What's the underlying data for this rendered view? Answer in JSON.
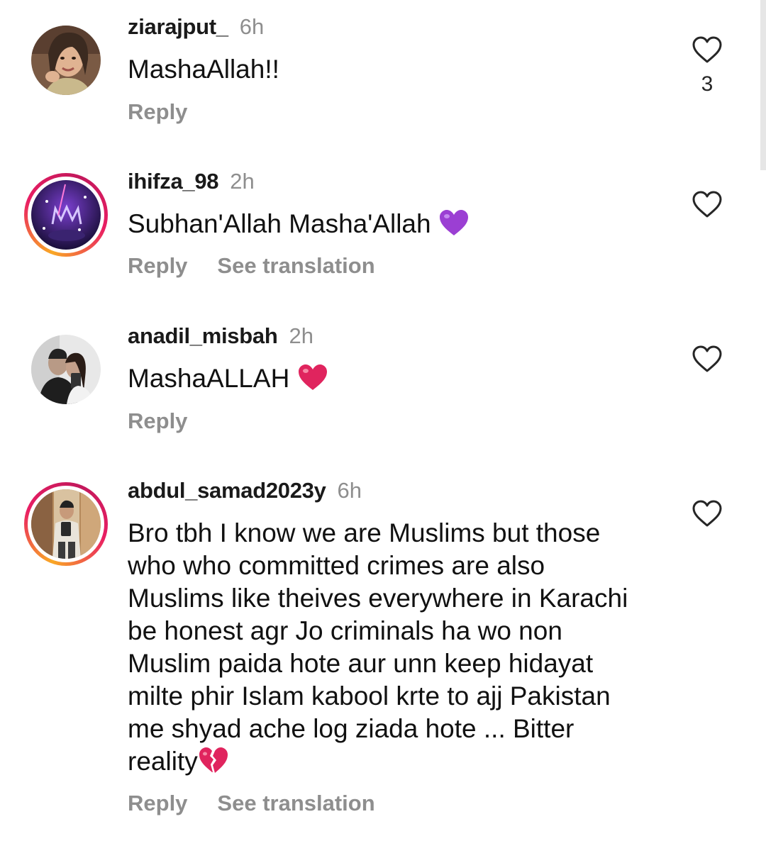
{
  "comments": [
    {
      "username": "ziarajput_",
      "time": "6h",
      "text": "MashaAllah!!",
      "reply_label": "Reply",
      "likes": "3"
    },
    {
      "username": "ihifza_98",
      "time": "2h",
      "text": "Subhan'Allah Masha'Allah",
      "emoji": "purple-heart",
      "reply_label": "Reply",
      "translate_label": "See translation"
    },
    {
      "username": "anadil_misbah",
      "time": "2h",
      "text": "MashaALLAH",
      "emoji": "red-heart",
      "reply_label": "Reply"
    },
    {
      "username": "abdul_samad2023y",
      "time": "6h",
      "text_lines": [
        "Bro tbh I know we are Muslims but those",
        "who who committed crimes are also",
        "Muslims like theives everywhere in Karachi",
        "be honest agr Jo criminals ha wo non",
        "Muslim paida hote aur unn keep hidayat",
        "milte phir Islam kabool krte to ajj Pakistan",
        "me shyad ache log ziada hote ... Bitter",
        "reality"
      ],
      "emoji": "broken-heart",
      "reply_label": "Reply",
      "translate_label": "See translation"
    }
  ],
  "icons": {
    "like": "heart-outline-icon"
  },
  "colors": {
    "secondary_text": "#8e8e8e",
    "story_ring_start": "#f9a825",
    "story_ring_end": "#e91e63",
    "purple_heart": "#9b3fd3",
    "red_heart": "#e0245e"
  }
}
